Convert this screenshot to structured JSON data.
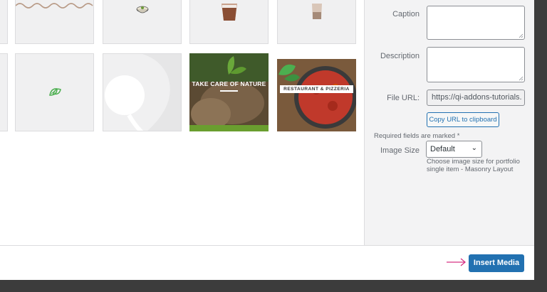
{
  "sidebar": {
    "caption_label": "Caption",
    "description_label": "Description",
    "file_url_label": "File URL:",
    "file_url_value": "https://qi-addons-tutorials.",
    "copy_url_label": "Copy URL to clipboard",
    "required_note": "Required fields are marked *",
    "image_size_label": "Image Size",
    "image_size_value": "Default",
    "image_size_hint": "Choose image size for portfolio single item - Masonry Layout"
  },
  "thumbnails": {
    "nature_title": "TAKE CARE OF NATURE",
    "restaurant_title": "RESTAURANT & PIZZERIA"
  },
  "footer": {
    "insert_label": "Insert Media"
  },
  "colors": {
    "primary": "#2271b1",
    "arrow": "#d63384",
    "overlay": "#3c3c3c"
  }
}
